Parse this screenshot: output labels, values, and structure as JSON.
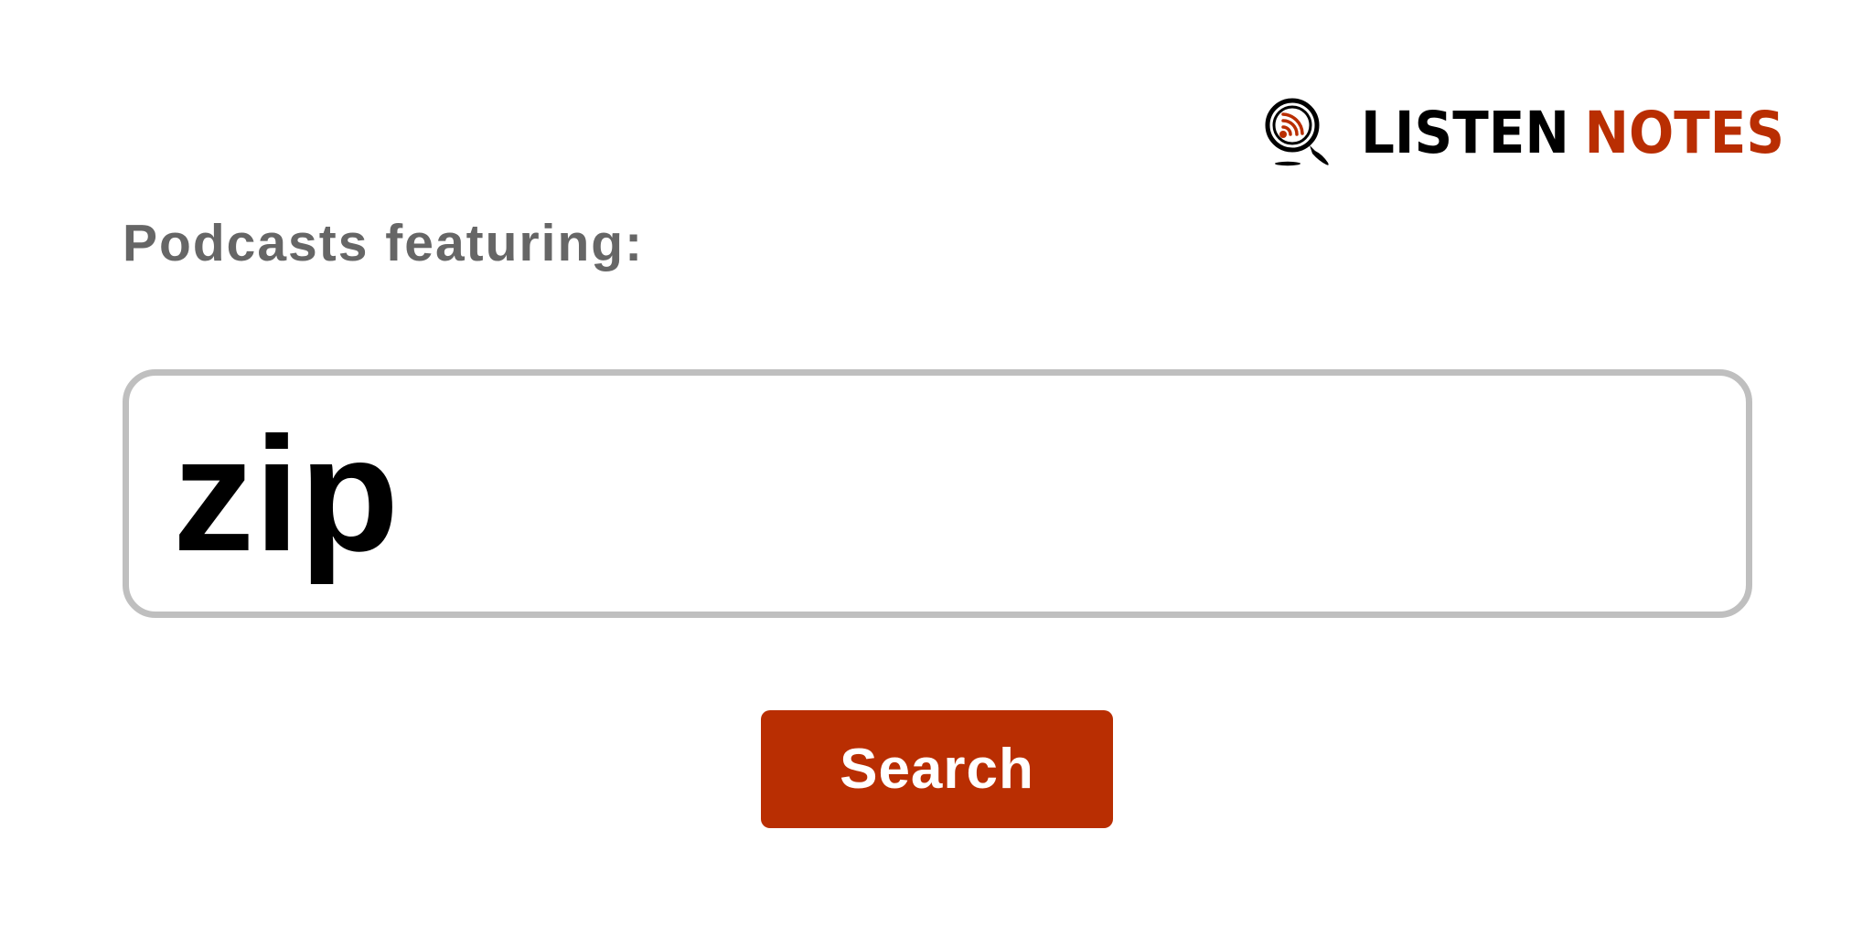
{
  "brand": {
    "name_part1": "LISTEN",
    "name_part2": "NOTES",
    "icon": "magnifier-podcast-icon",
    "colors": {
      "primary_text": "#000000",
      "accent": "#b92e02"
    }
  },
  "heading": {
    "text": "Podcasts featuring:",
    "color": "#666666"
  },
  "search": {
    "value": "zip",
    "border_color": "#bfbfbf"
  },
  "button": {
    "label": "Search",
    "background": "#b92e02",
    "text_color": "#ffffff"
  }
}
